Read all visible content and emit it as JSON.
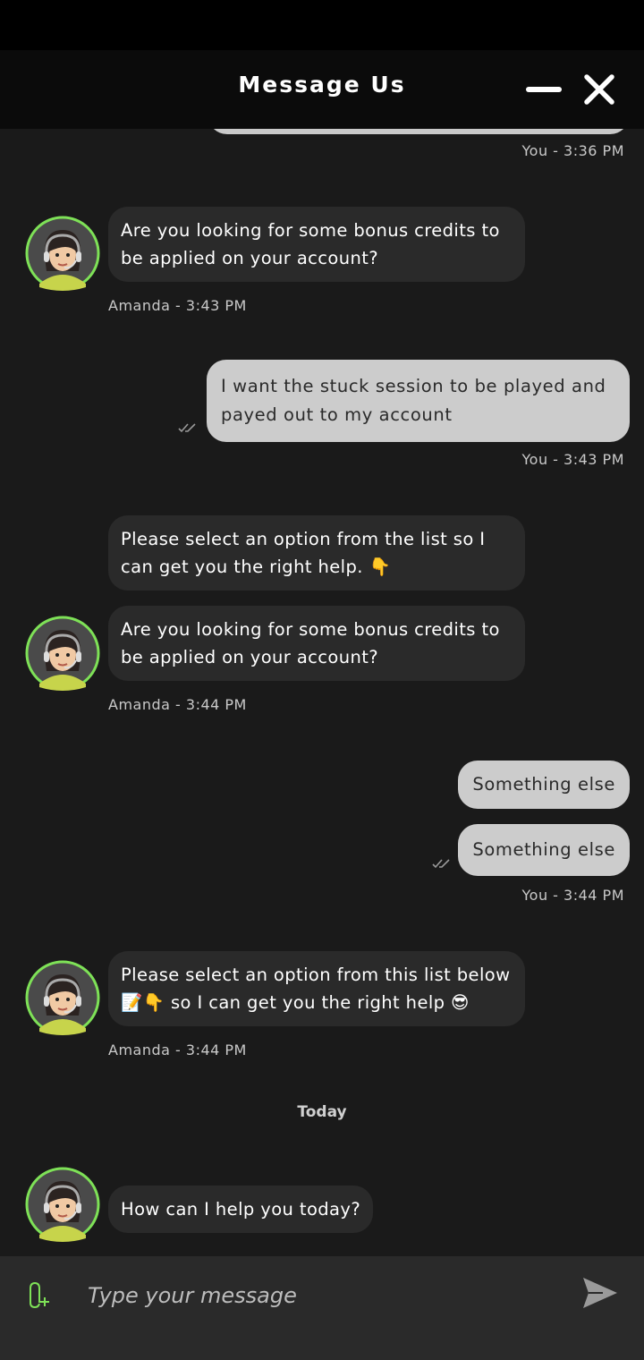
{
  "header": {
    "title": "Message Us"
  },
  "accent_color": "#7ee157",
  "messages": [
    {
      "id": "m0",
      "meta": "You - 3:36 PM"
    },
    {
      "id": "m1",
      "text": "Are you looking for some bonus credits to be applied on your account?",
      "meta": "Amanda - 3:43 PM"
    },
    {
      "id": "m2",
      "text": "I want the stuck session to be played and payed out to my account",
      "meta": "You - 3:43 PM"
    },
    {
      "id": "m3",
      "texts": [
        "Please select an option from the list so I can get you the right help. 👇",
        "Are you looking for some bonus credits to be applied on your account?"
      ],
      "meta": "Amanda - 3:44 PM"
    },
    {
      "id": "m4",
      "texts": [
        "Something else",
        "Something else"
      ],
      "meta": "You - 3:44 PM"
    },
    {
      "id": "m5",
      "text": "Please select an option from this list below 📝👇 so I can get you the right help 😎",
      "meta": "Amanda - 3:44 PM"
    },
    {
      "id": "m6",
      "text": "How can I help you today?"
    }
  ],
  "divider": {
    "today": "Today"
  },
  "composer": {
    "placeholder": "Type your message"
  }
}
